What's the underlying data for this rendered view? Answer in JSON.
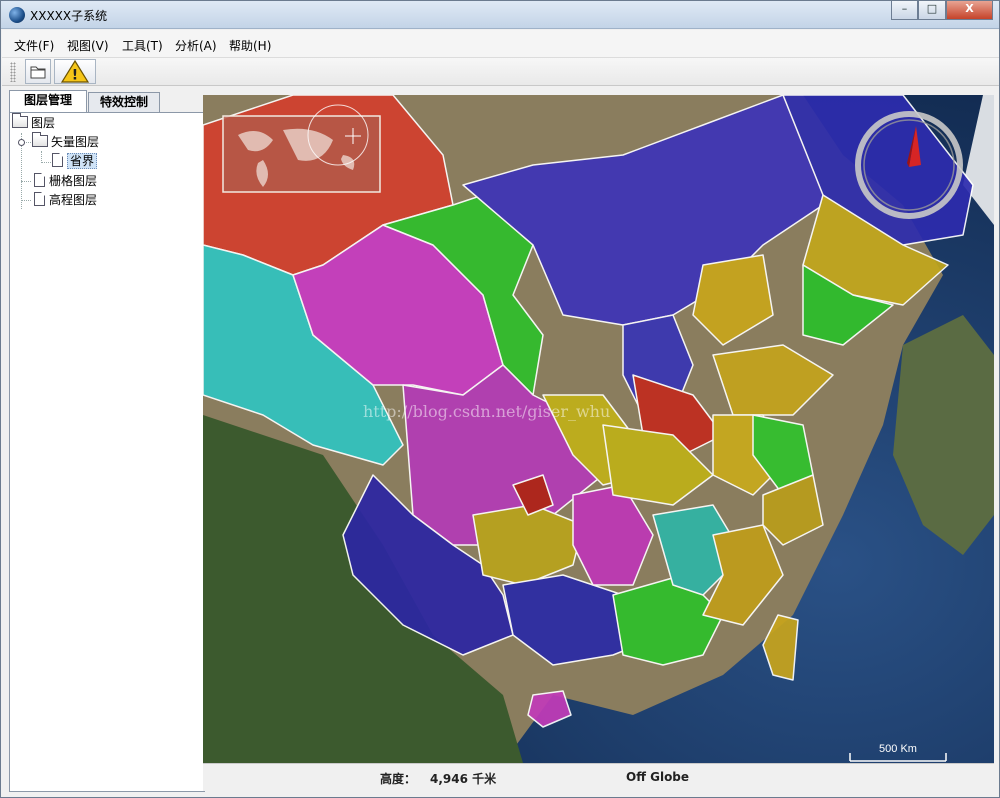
{
  "window": {
    "title": "XXXXX子系统"
  },
  "window_controls": {
    "minimize": "–",
    "maximize": "□",
    "close": "X"
  },
  "menu": [
    {
      "label": "文件(F)"
    },
    {
      "label": "视图(V)"
    },
    {
      "label": "工具(T)"
    },
    {
      "label": "分析(A)"
    },
    {
      "label": "帮助(H)"
    }
  ],
  "toolbar": {
    "buttons": [
      {
        "icon": "open-folder-icon"
      },
      {
        "icon": "warning-icon",
        "glyph": "!"
      }
    ]
  },
  "left_panel": {
    "tabs": [
      {
        "label": "图层管理",
        "active": true
      },
      {
        "label": "特效控制",
        "active": false
      }
    ],
    "tree": {
      "root": "图层",
      "vector": "矢量图层",
      "vector_child": "省界",
      "raster": "栅格图层",
      "elevation": "高程图层"
    }
  },
  "map": {
    "watermark": "http://blog.csdn.net/giser_whu",
    "scale_label": "500 Km"
  },
  "status": {
    "altitude_label": "高度：",
    "altitude_value": "4,946 千米",
    "globe_status": "Off Globe"
  }
}
